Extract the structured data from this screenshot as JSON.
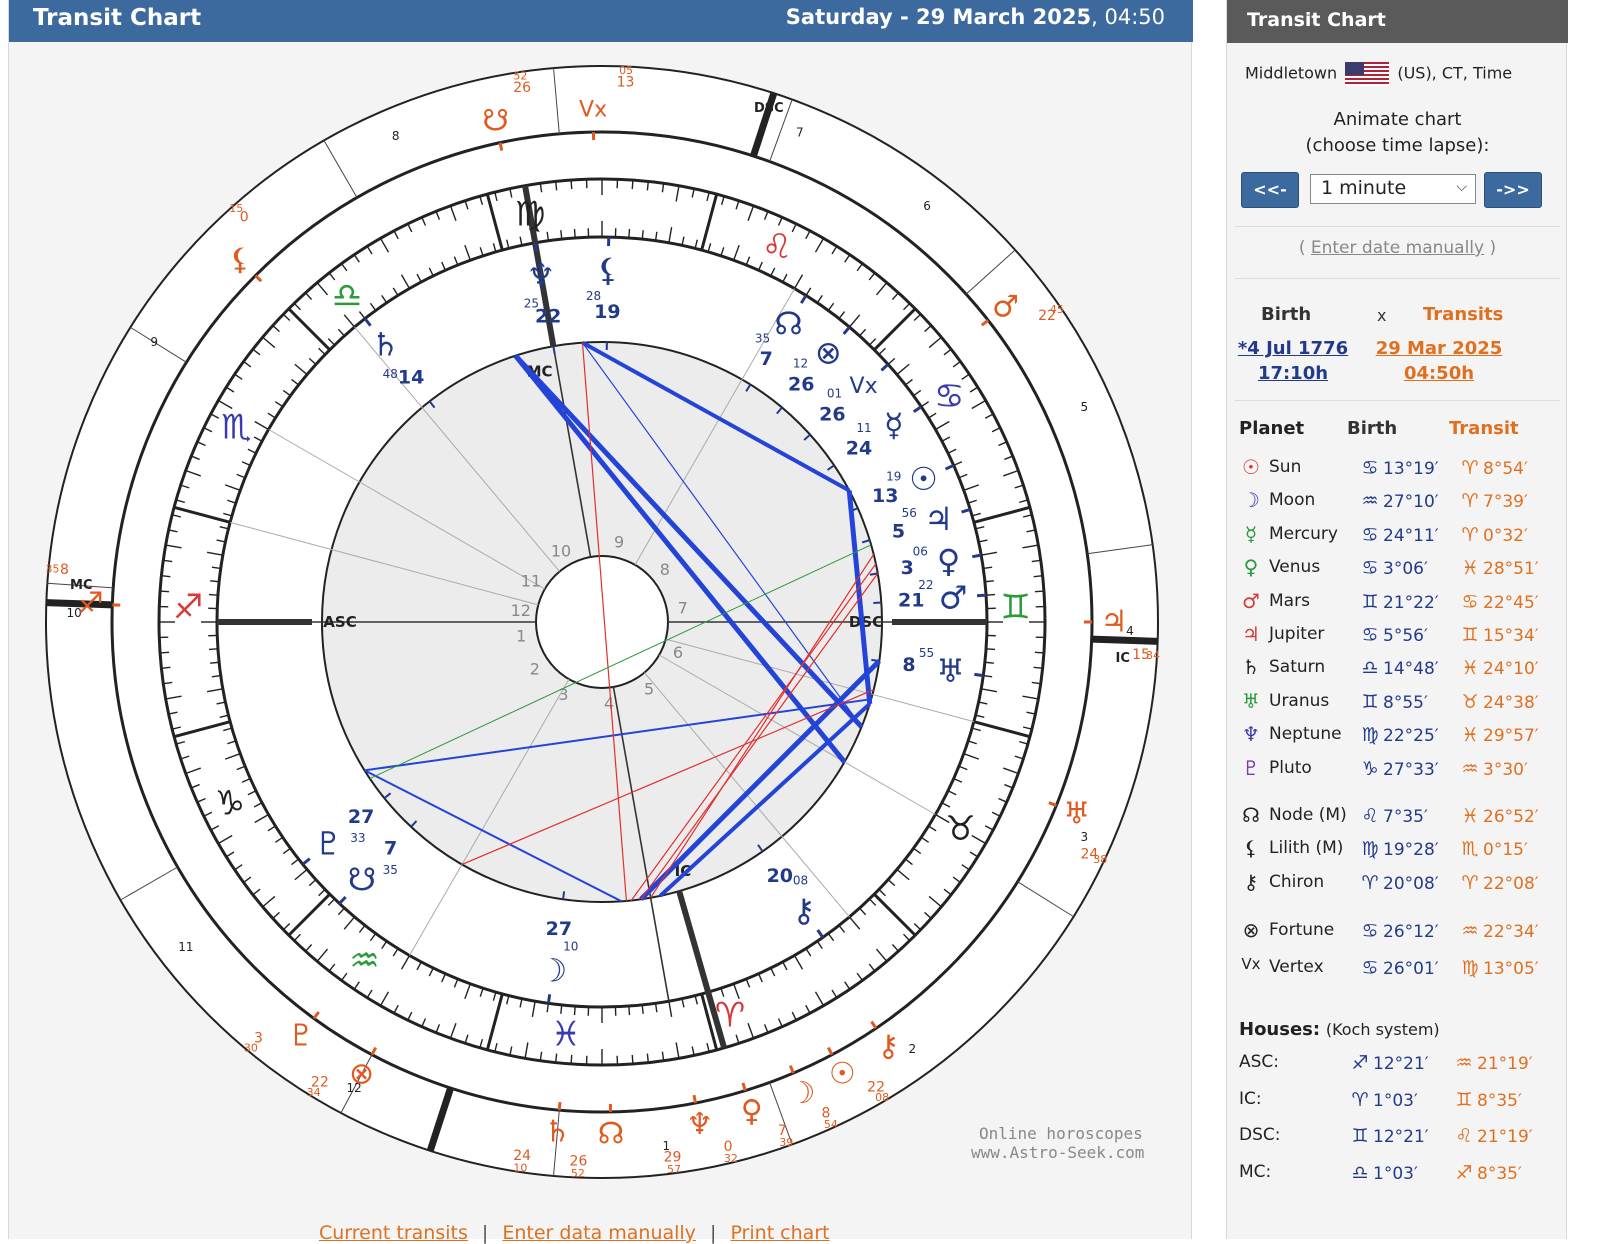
{
  "header": {
    "title": "Transit Chart",
    "date_bold": "Saturday - 29 March 2025",
    "time": ", 04:50"
  },
  "watermark": {
    "line1": "Online horoscopes",
    "line2": "www.Astro-Seek.com"
  },
  "bottom_links": [
    "Current transits",
    "Enter data manually",
    "Print chart"
  ],
  "sidebar": {
    "title": "Transit Chart",
    "location": {
      "city": "Middletown",
      "rest": "(US), CT, Time"
    },
    "animate": {
      "line1": "Animate chart",
      "line2": "(choose time lapse):"
    },
    "prev_label": "<<-",
    "next_label": "->>",
    "time_lapse": "1 minute",
    "enter_date": {
      "open": "( ",
      "link": "Enter date manually",
      "close": " )"
    },
    "birth_label": "Birth",
    "x_label": "x",
    "transits_label": "Transits",
    "birth_date": "*4 Jul 1776",
    "birth_time": "17:10h",
    "transit_date": "29 Mar 2025",
    "transit_time": "04:50h",
    "col_planet": "Planet",
    "col_birth": "Birth",
    "col_transit": "Transit",
    "planets": [
      {
        "glyph": "☉",
        "color": "#d63a3a",
        "name": "Sun",
        "b_sign": "♋",
        "b_deg": "13°19′",
        "t_sign": "♈",
        "t_deg": "8°54′"
      },
      {
        "glyph": "☽",
        "color": "#3a3ab0",
        "name": "Moon",
        "b_sign": "♒",
        "b_deg": "27°10′",
        "t_sign": "♈",
        "t_deg": "7°39′"
      },
      {
        "glyph": "☿",
        "color": "#2a9a3a",
        "name": "Mercury",
        "b_sign": "♋",
        "b_deg": "24°11′",
        "t_sign": "♈",
        "t_deg": "0°32′"
      },
      {
        "glyph": "♀",
        "color": "#2a9a3a",
        "name": "Venus",
        "b_sign": "♋",
        "b_deg": "3°06′",
        "t_sign": "♓",
        "t_deg": "28°51′"
      },
      {
        "glyph": "♂",
        "color": "#d63a3a",
        "name": "Mars",
        "b_sign": "♊",
        "b_deg": "21°22′",
        "t_sign": "♋",
        "t_deg": "22°45′"
      },
      {
        "glyph": "♃",
        "color": "#d63a3a",
        "name": "Jupiter",
        "b_sign": "♋",
        "b_deg": "5°56′",
        "t_sign": "♊",
        "t_deg": "15°34′"
      },
      {
        "glyph": "♄",
        "color": "#222",
        "name": "Saturn",
        "b_sign": "♎",
        "b_deg": "14°48′",
        "t_sign": "♓",
        "t_deg": "24°10′"
      },
      {
        "glyph": "♅",
        "color": "#2a9a3a",
        "name": "Uranus",
        "b_sign": "♊",
        "b_deg": "8°55′",
        "t_sign": "♉",
        "t_deg": "24°38′"
      },
      {
        "glyph": "♆",
        "color": "#3a3ab0",
        "name": "Neptune",
        "b_sign": "♍",
        "b_deg": "22°25′",
        "t_sign": "♓",
        "t_deg": "29°57′"
      },
      {
        "glyph": "♇",
        "color": "#7a3ab0",
        "name": "Pluto",
        "b_sign": "♑",
        "b_deg": "27°33′",
        "t_sign": "♒",
        "t_deg": "3°30′"
      }
    ],
    "points": [
      {
        "glyph": "☊",
        "color": "#222",
        "name": "Node (M)",
        "b_sign": "♌",
        "b_deg": "7°35′",
        "t_sign": "♓",
        "t_deg": "26°52′"
      },
      {
        "glyph": "⚸",
        "color": "#222",
        "name": "Lilith (M)",
        "b_sign": "♍",
        "b_deg": "19°28′",
        "t_sign": "♏",
        "t_deg": "0°15′"
      },
      {
        "glyph": "⚷",
        "color": "#222",
        "name": "Chiron",
        "b_sign": "♈",
        "b_deg": "20°08′",
        "t_sign": "♈",
        "t_deg": "22°08′"
      }
    ],
    "extra": [
      {
        "glyph": "⊗",
        "color": "#222",
        "name": "Fortune",
        "b_sign": "♋",
        "b_deg": "26°12′",
        "t_sign": "♒",
        "t_deg": "22°34′"
      },
      {
        "glyph": "Vx",
        "color": "#222",
        "name": "Vertex",
        "b_sign": "♋",
        "b_deg": "26°01′",
        "t_sign": "♍",
        "t_deg": "13°05′"
      }
    ],
    "houses_label": "Houses:",
    "houses_system": "(Koch system)",
    "houses": [
      {
        "name": "ASC:",
        "b_sign": "♐",
        "b_deg": "12°21′",
        "t_sign": "♒",
        "t_deg": "21°19′"
      },
      {
        "name": "IC:",
        "b_sign": "♈",
        "b_deg": "1°03′",
        "t_sign": "♊",
        "t_deg": "8°35′"
      },
      {
        "name": "DSC:",
        "b_sign": "♊",
        "b_deg": "12°21′",
        "t_sign": "♌",
        "t_deg": "21°19′"
      },
      {
        "name": "MC:",
        "b_sign": "♎",
        "b_deg": "1°03′",
        "t_sign": "♐",
        "t_deg": "8°35′"
      }
    ]
  },
  "wheel": {
    "angle_labels": {
      "asc": "ASC",
      "dsc": "DSC",
      "mc": "MC",
      "ic": "IC"
    },
    "zodiac": [
      {
        "glyph": "♍",
        "color": "#222",
        "deg": 100
      },
      {
        "glyph": "♌",
        "color": "#d63a3a",
        "deg": 65
      },
      {
        "glyph": "♋",
        "color": "#3a3ab0",
        "deg": 33
      },
      {
        "glyph": "♊",
        "color": "#2a9a3a",
        "deg": 2
      },
      {
        "glyph": "♉",
        "color": "#222",
        "deg": -30
      },
      {
        "glyph": "♈",
        "color": "#d63a3a",
        "deg": -72
      },
      {
        "glyph": "♓",
        "color": "#3a3ab0",
        "deg": -95
      },
      {
        "glyph": "♒",
        "color": "#2a9a3a",
        "deg": -125
      },
      {
        "glyph": "♑",
        "color": "#222",
        "deg": -154
      },
      {
        "glyph": "♐",
        "color": "#d63a3a",
        "deg": 178
      },
      {
        "glyph": "♏",
        "color": "#3a3ab0",
        "deg": 152
      },
      {
        "glyph": "♎",
        "color": "#2a9a3a",
        "deg": 128
      }
    ],
    "outer_house_numbers": [
      {
        "label": "7",
        "deg": 68
      },
      {
        "label": "8",
        "deg": 113
      },
      {
        "label": "9",
        "deg": 148
      },
      {
        "label": "10",
        "deg": 179
      },
      {
        "label": "11",
        "deg": -142
      },
      {
        "label": "12",
        "deg": -118
      },
      {
        "label": "1",
        "deg": -83
      },
      {
        "label": "2",
        "deg": -54
      },
      {
        "label": "3",
        "deg": -24
      },
      {
        "label": "4",
        "deg": -1
      },
      {
        "label": "5",
        "deg": 24
      },
      {
        "label": "6",
        "deg": 52
      }
    ],
    "inner_house_numbers": [
      {
        "label": "1",
        "deg": -170
      },
      {
        "label": "2",
        "deg": -145
      },
      {
        "label": "3",
        "deg": -118
      },
      {
        "label": "4",
        "deg": -85
      },
      {
        "label": "5",
        "deg": -55
      },
      {
        "label": "6",
        "deg": -22
      },
      {
        "label": "7",
        "deg": 10
      },
      {
        "label": "8",
        "deg": 40
      },
      {
        "label": "9",
        "deg": 78
      },
      {
        "label": "10",
        "deg": 120
      },
      {
        "label": "11",
        "deg": 150
      },
      {
        "label": "12",
        "deg": 172
      }
    ],
    "natal_planets": [
      {
        "glyph": "♆",
        "deg": 100,
        "num": "22",
        "sub": "25"
      },
      {
        "glyph": "⚸",
        "deg": 89,
        "num": "19",
        "sub": "28"
      },
      {
        "glyph": "♄",
        "deg": 128,
        "num": "14",
        "sub": "48"
      },
      {
        "glyph": "☊",
        "deg": 58,
        "num": "7",
        "sub": "35"
      },
      {
        "glyph": "⊗",
        "deg": 50,
        "num": "26",
        "sub": "12"
      },
      {
        "glyph": "Vx",
        "deg": 42,
        "num": "26",
        "sub": "01"
      },
      {
        "glyph": "☿",
        "deg": 34,
        "num": "24",
        "sub": "11"
      },
      {
        "glyph": "☉",
        "deg": 24,
        "num": "13",
        "sub": "19"
      },
      {
        "glyph": "♃",
        "deg": 17,
        "num": "5",
        "sub": "56"
      },
      {
        "glyph": "♀",
        "deg": 10,
        "num": "3",
        "sub": "06"
      },
      {
        "glyph": "♂",
        "deg": 4,
        "num": "21",
        "sub": "22"
      },
      {
        "glyph": "♅",
        "deg": -8,
        "num": "8",
        "sub": "55"
      },
      {
        "glyph": "⚷",
        "deg": -55,
        "num": "20",
        "sub": "08"
      },
      {
        "glyph": "☽",
        "deg": -98,
        "num": "27",
        "sub": "10"
      },
      {
        "glyph": "☋",
        "deg": -133,
        "num": "7",
        "sub": "35"
      },
      {
        "glyph": "♇",
        "deg": -141,
        "num": "27",
        "sub": "33"
      }
    ],
    "transit_planets": [
      {
        "glyph": "☋",
        "deg": 102,
        "num": "26",
        "sub": "52"
      },
      {
        "glyph": "Vx",
        "deg": 91,
        "num": "13",
        "sub": "05"
      },
      {
        "glyph": "⚸",
        "deg": 135,
        "num": "0",
        "sub": "15"
      },
      {
        "glyph": "♂",
        "deg": 38,
        "num": "22",
        "sub": "45"
      },
      {
        "glyph": "♃",
        "deg": 0,
        "num": "15",
        "sub": "34"
      },
      {
        "glyph": "♅",
        "deg": -22,
        "num": "24",
        "sub": "38"
      },
      {
        "glyph": "⚷",
        "deg": -56,
        "num": "22",
        "sub": "08"
      },
      {
        "glyph": "☉",
        "deg": -62,
        "num": "8",
        "sub": "54"
      },
      {
        "glyph": "☽",
        "deg": -67,
        "num": "7",
        "sub": "39"
      },
      {
        "glyph": "♀",
        "deg": -73,
        "num": "0",
        "sub": "32"
      },
      {
        "glyph": "♆",
        "deg": -79,
        "num": "29",
        "sub": "57"
      },
      {
        "glyph": "♄",
        "deg": -95,
        "num": "24",
        "sub": "10"
      },
      {
        "glyph": "☊",
        "deg": -89,
        "num": "26",
        "sub": "52"
      },
      {
        "glyph": "♇",
        "deg": -126,
        "num": "3",
        "sub": "30"
      },
      {
        "glyph": "⊗",
        "deg": -118,
        "num": "22",
        "sub": "34"
      },
      {
        "glyph": "♐",
        "deg": 178,
        "num": "8",
        "sub": "35"
      }
    ]
  }
}
